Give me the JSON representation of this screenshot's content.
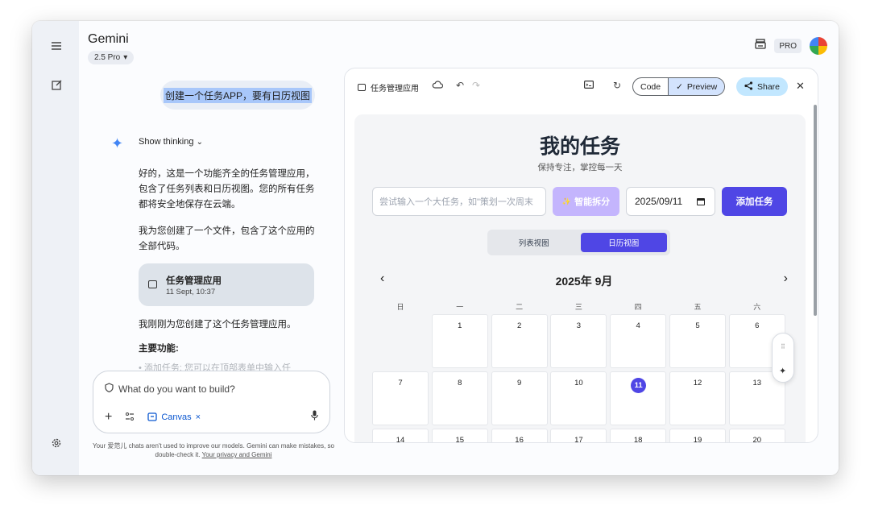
{
  "app": {
    "brand": "Gemini",
    "model": "2.5 Pro",
    "pro_badge": "PRO"
  },
  "chat": {
    "user_prompt": "创建一个任务APP，要有日历视图",
    "thinking_label": "Show thinking",
    "reply_p1_l1": "好的，这是一个功能齐全的任务管理应用，",
    "reply_p1_l2": "包含了任务列表和日历视图。您的所有任务",
    "reply_p1_l3": "都将安全地保存在云端。",
    "reply_p2_l1": "我为您创建了一个文件，包含了这个应用的",
    "reply_p2_l2": "全部代码。",
    "file_card": {
      "title": "任务管理应用",
      "timestamp": "11 Sept, 10:37"
    },
    "reply_p3": "我刚刚为您创建了这个任务管理应用。",
    "features_heading": "主要功能:",
    "faded_item": "添加任务: 您可以在顶部表单中输入任"
  },
  "composer": {
    "placeholder": "What do you want to build?",
    "canvas_chip": "Canvas",
    "disclaimer": "Your 爱范儿 chats aren't used to improve our models. Gemini can make mistakes, so double-check it.",
    "privacy_link": "Your privacy and Gemini"
  },
  "canvas": {
    "title": "任务管理应用",
    "code_tab": "Code",
    "preview_tab": "Preview",
    "share_label": "Share"
  },
  "task_app": {
    "title": "我的任务",
    "subtitle": "保持专注，掌控每一天",
    "task_placeholder": "尝试输入一个大任务，如\"策划一次周末",
    "ai_split_label": "智能拆分",
    "date_value": "2025/09/11",
    "add_button": "添加任务",
    "list_view": "列表视图",
    "calendar_view": "日历视图",
    "month_title": "2025年 9月",
    "weekdays": [
      "日",
      "一",
      "二",
      "三",
      "四",
      "五",
      "六"
    ],
    "weeks": [
      [
        "",
        "1",
        "2",
        "3",
        "4",
        "5",
        "6"
      ],
      [
        "7",
        "8",
        "9",
        "10",
        "11",
        "12",
        "13"
      ],
      [
        "14",
        "15",
        "16",
        "17",
        "18",
        "19",
        "20"
      ]
    ],
    "today": "11"
  },
  "colors": {
    "accent": "#4f46e5",
    "ai_button": "#c4b5fd",
    "share": "#c2e7ff"
  }
}
